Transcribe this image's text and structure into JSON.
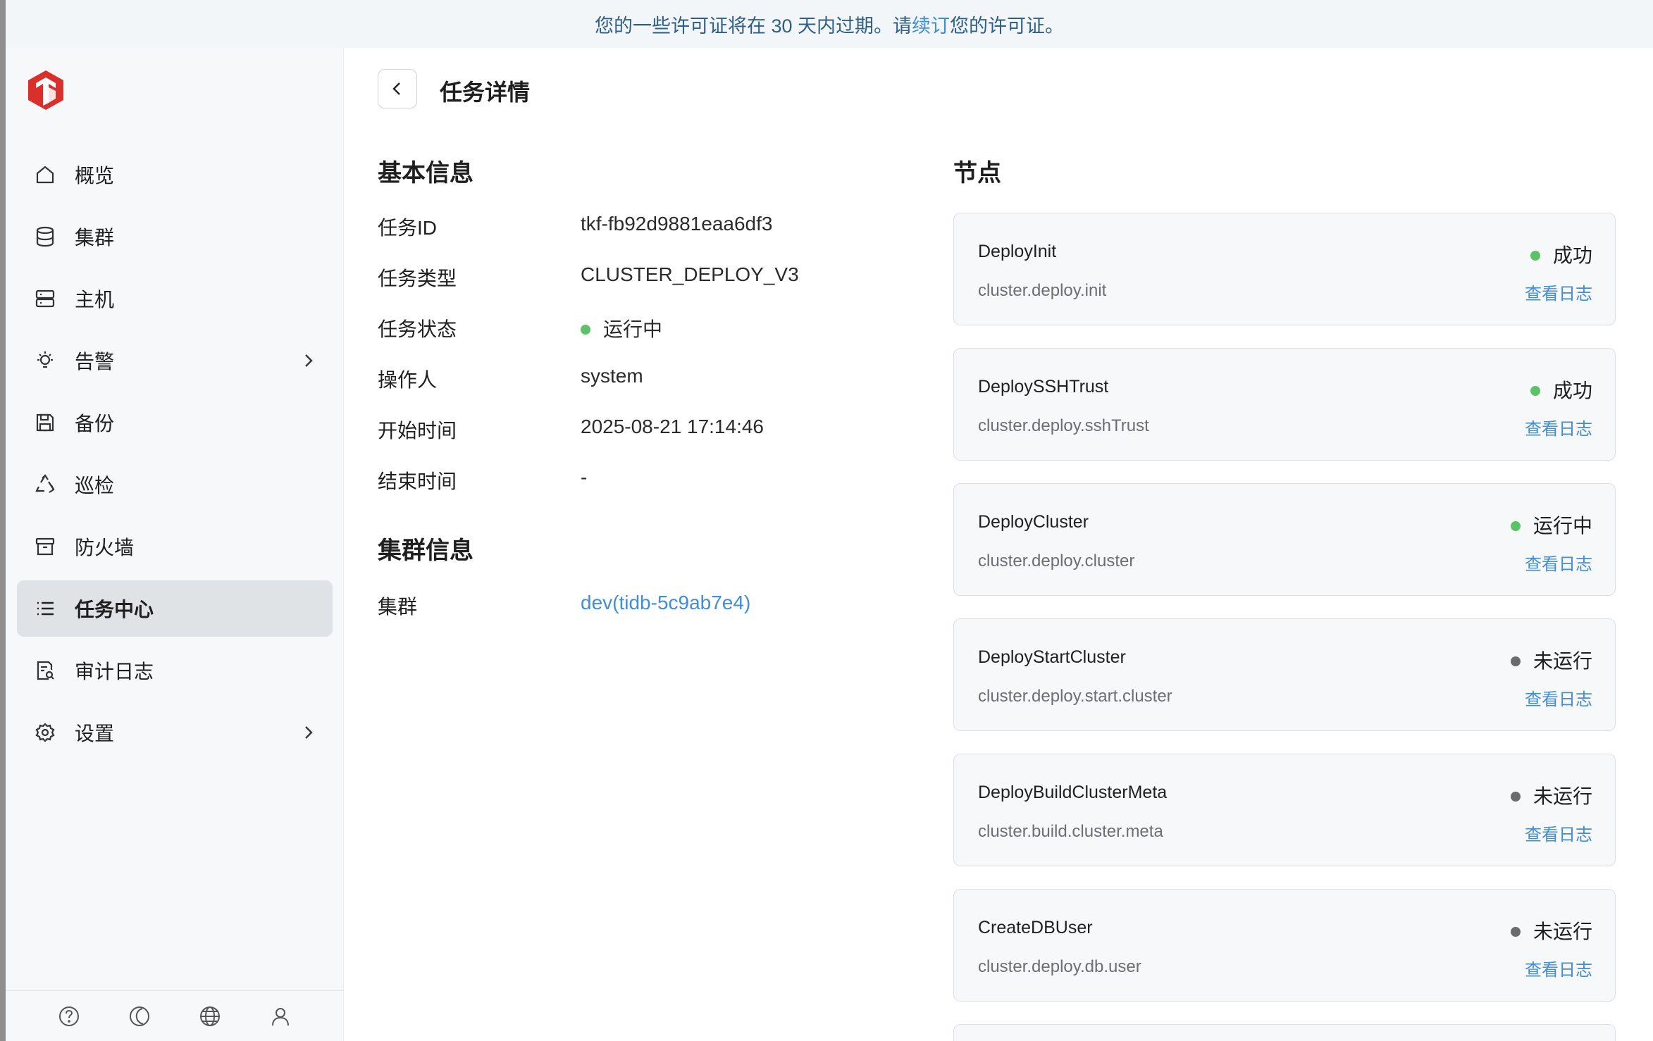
{
  "banner": {
    "before": "您的一些许可证将在 30 天内过期。请",
    "link": "续订",
    "after": "您的许可证。"
  },
  "sidebar": {
    "items": [
      {
        "label": "概览",
        "icon": "home-icon",
        "active": false
      },
      {
        "label": "集群",
        "icon": "database-icon",
        "active": false
      },
      {
        "label": "主机",
        "icon": "server-icon",
        "active": false
      },
      {
        "label": "告警",
        "icon": "bulb-icon",
        "active": false,
        "expandable": true
      },
      {
        "label": "备份",
        "icon": "save-icon",
        "active": false
      },
      {
        "label": "巡检",
        "icon": "recycle-icon",
        "active": false
      },
      {
        "label": "防火墙",
        "icon": "archive-icon",
        "active": false
      },
      {
        "label": "任务中心",
        "icon": "list-icon",
        "active": true
      },
      {
        "label": "审计日志",
        "icon": "audit-icon",
        "active": false
      },
      {
        "label": "设置",
        "icon": "gear-icon",
        "active": false,
        "expandable": true
      }
    ],
    "footer_icons": [
      "help-icon",
      "theme-icon",
      "globe-icon",
      "user-icon"
    ]
  },
  "header": {
    "title": "任务详情"
  },
  "basic_info": {
    "title": "基本信息",
    "rows": [
      {
        "label": "任务ID",
        "value": "tkf-fb92d9881eaa6df3"
      },
      {
        "label": "任务类型",
        "value": "CLUSTER_DEPLOY_V3"
      },
      {
        "label": "任务状态",
        "value": "运行中",
        "status_color": "#5cc26a"
      },
      {
        "label": "操作人",
        "value": "system"
      },
      {
        "label": "开始时间",
        "value": "2025-08-21 17:14:46"
      },
      {
        "label": "结束时间",
        "value": "-"
      }
    ]
  },
  "cluster_info": {
    "title": "集群信息",
    "rows": [
      {
        "label": "集群",
        "value": "dev(tidb-5c9ab7e4)"
      }
    ]
  },
  "nodes": {
    "title": "节点",
    "items": [
      {
        "name": "DeployInit",
        "key": "cluster.deploy.init",
        "status": "成功",
        "status_color": "#5cc26a",
        "action": "查看日志"
      },
      {
        "name": "DeploySSHTrust",
        "key": "cluster.deploy.sshTrust",
        "status": "成功",
        "status_color": "#5cc26a",
        "action": "查看日志"
      },
      {
        "name": "DeployCluster",
        "key": "cluster.deploy.cluster",
        "status": "运行中",
        "status_color": "#5cc26a",
        "action": "查看日志"
      },
      {
        "name": "DeployStartCluster",
        "key": "cluster.deploy.start.cluster",
        "status": "未运行",
        "status_color": "#6b6b6b",
        "action": "查看日志"
      },
      {
        "name": "DeployBuildClusterMeta",
        "key": "cluster.build.cluster.meta",
        "status": "未运行",
        "status_color": "#6b6b6b",
        "action": "查看日志"
      },
      {
        "name": "CreateDBUser",
        "key": "cluster.deploy.db.user",
        "status": "未运行",
        "status_color": "#6b6b6b",
        "action": "查看日志"
      }
    ]
  },
  "colors": {
    "accent": "#3f8ed8",
    "success": "#5cc26a",
    "idle": "#6b6b6b",
    "brand": "#d9302c"
  }
}
